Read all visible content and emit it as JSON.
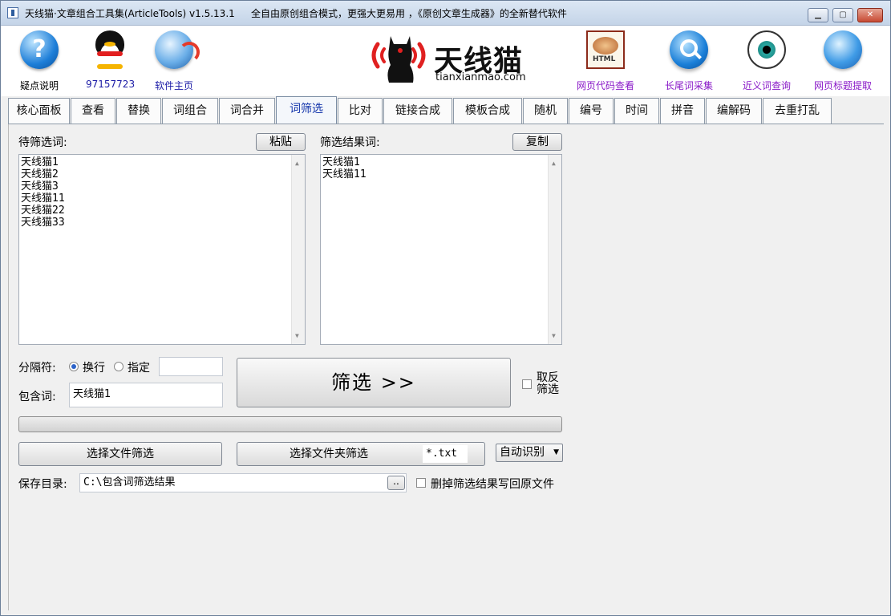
{
  "window": {
    "title": "天线猫·文章组合工具集(ArticleTools) v1.5.13.1",
    "slogan": "全自由原创组合模式，更强大更易用 ，《原创文章生成器》的全新替代软件",
    "controls": {
      "minimize": "▁",
      "maximize": "▢",
      "close": "✕"
    }
  },
  "toolbar": {
    "left": [
      {
        "icon": "help-icon",
        "label": "疑点说明"
      },
      {
        "icon": "qq-icon",
        "label": "97157723"
      },
      {
        "icon": "globe-icon",
        "label": "软件主页"
      }
    ],
    "logo": {
      "name": "天线猫",
      "domain": "tianxianmao.com"
    },
    "right": [
      {
        "icon": "html-icon",
        "label": "网页代码查看",
        "icon_text": "HTML"
      },
      {
        "icon": "search-icon",
        "label": "长尾词采集"
      },
      {
        "icon": "eye-icon",
        "label": "近义词查询"
      },
      {
        "icon": "web-icon",
        "label": "网页标题提取"
      }
    ]
  },
  "tabs": [
    "核心面板",
    "查看",
    "替换",
    "词组合",
    "词合并",
    "词筛选",
    "比对",
    "链接合成",
    "模板合成",
    "随机",
    "编号",
    "时间",
    "拼音",
    "编解码",
    "去重打乱"
  ],
  "active_tab": "词筛选",
  "filter": {
    "source_label": "待筛选词:",
    "paste_button": "粘贴",
    "source_words": [
      "天线猫1",
      "天线猫2",
      "天线猫3",
      "天线猫11",
      "天线猫22",
      "天线猫33"
    ],
    "result_label": "筛选结果词:",
    "copy_button": "复制",
    "result_words": [
      "天线猫1",
      "天线猫11"
    ],
    "separator_label": "分隔符:",
    "sep_newline": "换行",
    "sep_custom": "指定",
    "sep_newline_selected": true,
    "sep_custom_value": "",
    "contains_label": "包含词:",
    "contains_value": "天线猫1",
    "filter_button": "筛选  >>",
    "invert_label_1": "取反",
    "invert_label_2": "筛选",
    "invert_checked": false,
    "progress": 0,
    "choose_file_button": "选择文件筛选",
    "choose_folder_button": "选择文件夹筛选",
    "file_pattern": "*.txt",
    "encoding_select": "自动识别",
    "save_dir_label": "保存目录:",
    "save_dir_value": "C:\\包含词筛选结果",
    "browse_button": "..",
    "delete_label": "删掉筛选结果写回原文件",
    "delete_checked": false
  }
}
